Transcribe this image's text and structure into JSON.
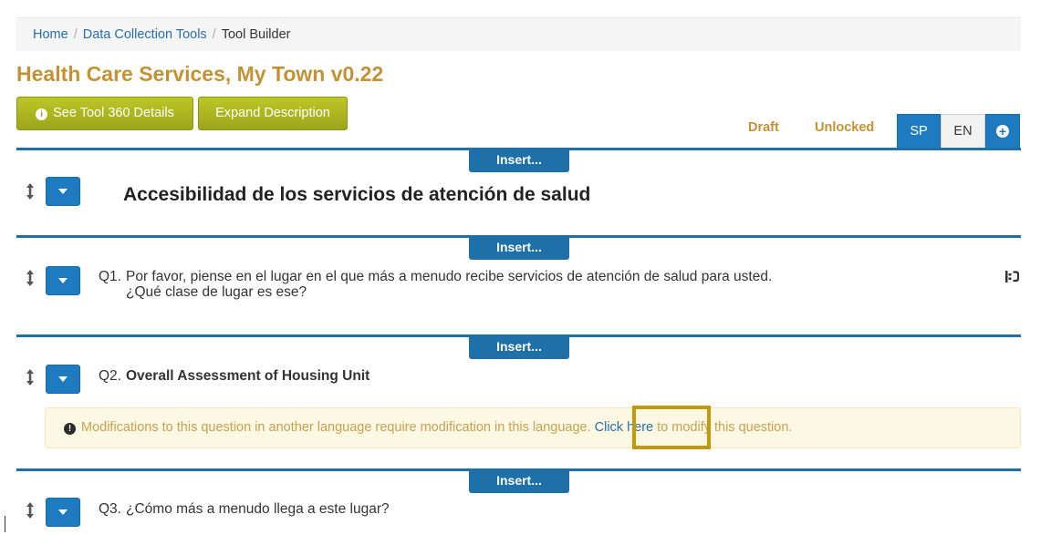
{
  "breadcrumb": {
    "home": "Home",
    "tools": "Data Collection Tools",
    "current": "Tool Builder",
    "separator": "/"
  },
  "page_title": "Health Care Services, My Town v0.22",
  "toolbar": {
    "details_label": "See Tool 360 Details",
    "expand_label": "Expand Description"
  },
  "status": {
    "draft": "Draft",
    "lock": "Unlocked"
  },
  "languages": {
    "sp": "SP",
    "en": "EN",
    "selected": "SP"
  },
  "insert_label": "Insert...",
  "section": {
    "title": "Accesibilidad de los servicios de atención de salud"
  },
  "questions": [
    {
      "num": "Q1.",
      "line1": "Por favor, piense en el lugar en el que más a menudo recibe servicios de atención de salud para usted.",
      "line2": "¿Qué clase de lugar es ese?"
    },
    {
      "num": "Q2.",
      "text": "Overall Assessment of Housing Unit"
    },
    {
      "num": "Q3.",
      "text": "¿Cómo más a menudo llega a este lugar?"
    }
  ],
  "alert": {
    "before": "Modifications to this question in another language require modification in this language. ",
    "link": "Click here",
    "after": " to modify this question."
  },
  "icons": {
    "info": "info-circle-icon",
    "add": "plus-circle-icon",
    "drag": "drag-handle-icon",
    "collapse": "caret-down-icon",
    "translate": "translate-icon",
    "warning": "exclamation-circle-icon"
  },
  "colors": {
    "accent": "#c19336",
    "primary": "#1f7bbf",
    "olive": "#a2aa1e",
    "rule": "#1f6fa8",
    "alert_bg": "#fcf8e3",
    "highlight": "#c19a0c"
  }
}
